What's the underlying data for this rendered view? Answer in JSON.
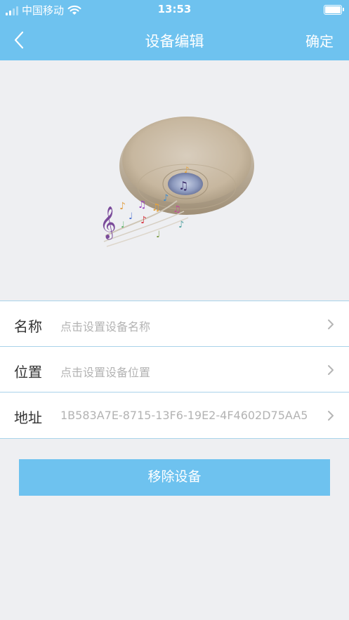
{
  "status_bar": {
    "carrier": "中国移动",
    "time": "13:53"
  },
  "nav": {
    "title": "设备编辑",
    "confirm": "确定"
  },
  "form": {
    "name": {
      "label": "名称",
      "placeholder": "点击设置设备名称"
    },
    "location": {
      "label": "位置",
      "placeholder": "点击设置设备位置"
    },
    "address": {
      "label": "地址",
      "value": "1B583A7E-8715-13F6-19E2-4F4602D75AA5"
    }
  },
  "actions": {
    "remove": "移除设备"
  },
  "colors": {
    "accent": "#6ec2ef",
    "background": "#eeeff2",
    "divider": "#a9d3ea"
  },
  "icons": [
    "signal-icon",
    "wifi-icon",
    "battery-icon",
    "back-chevron-icon",
    "chevron-right-icon",
    "ceiling-speaker-lamp-image"
  ]
}
